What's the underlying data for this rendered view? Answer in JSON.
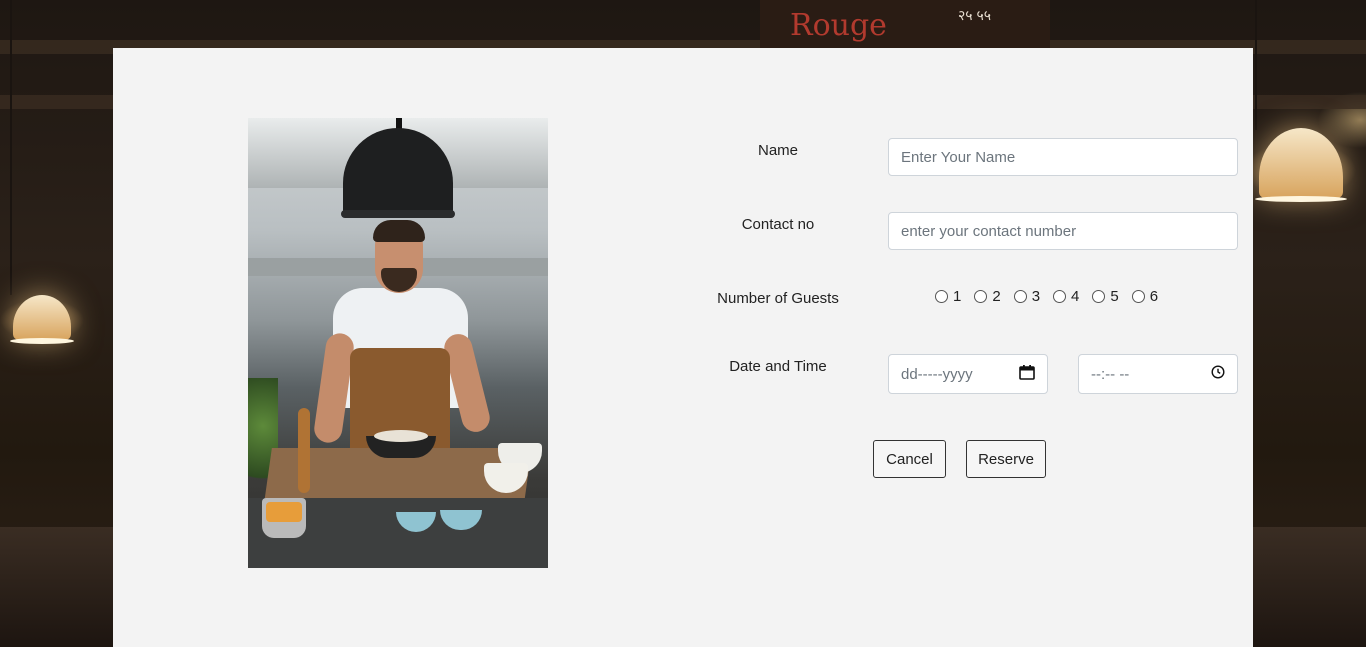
{
  "background": {
    "board_text": "Rouge",
    "board_note": "२५ ५५"
  },
  "form": {
    "name": {
      "label": "Name",
      "placeholder": "Enter Your Name"
    },
    "contact": {
      "label": "Contact no",
      "placeholder": "enter your contact number"
    },
    "guests": {
      "label": "Number of Guests",
      "options": [
        "1",
        "2",
        "3",
        "4",
        "5",
        "6"
      ]
    },
    "datetime": {
      "label": "Date and Time",
      "date_placeholder": "dd-----yyyy",
      "time_placeholder": "--:-- --"
    },
    "buttons": {
      "cancel": "Cancel",
      "reserve": "Reserve"
    }
  },
  "colors": {
    "card_bg": "#f3f3f3",
    "input_border": "#ced4da",
    "placeholder": "#6c757d"
  },
  "icons": {
    "date": "calendar-icon",
    "time": "clock-icon"
  }
}
